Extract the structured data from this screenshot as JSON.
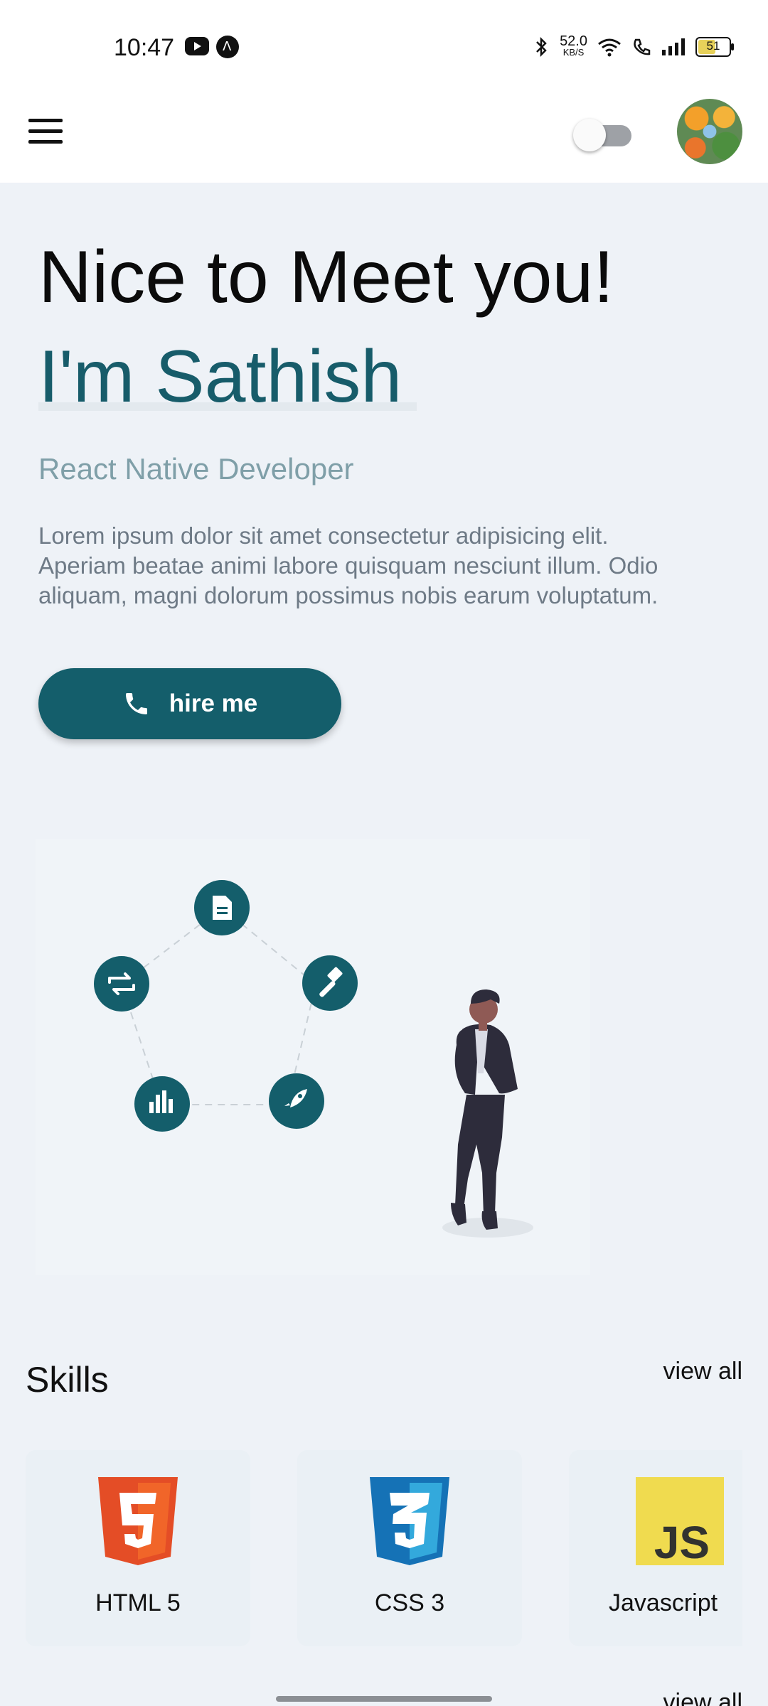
{
  "status_bar": {
    "time": "10:47",
    "net_speed": "52.0",
    "net_unit": "KB/S",
    "battery": "51",
    "icons": [
      "youtube-icon",
      "navigation-a-icon",
      "bluetooth-icon",
      "wifi-icon",
      "call-icon",
      "signal-icon",
      "battery-icon"
    ]
  },
  "app_bar": {
    "menu_icon": "hamburger-menu-icon",
    "toggle_on": false
  },
  "hero": {
    "greeting": "Nice to Meet you!",
    "name": "I'm Sathish",
    "role": "React Native Developer",
    "description": "Lorem ipsum dolor sit amet consectetur adipisicing elit. Aperiam beatae animi labore quisquam nesciunt illum. Odio aliquam, magni dolorum possimus nobis earum voluptatum.",
    "hire_button": "hire me",
    "hire_icon": "phone-icon"
  },
  "illustration": {
    "cycle_icons": [
      "document-icon",
      "hammer-icon",
      "rocket-icon",
      "bar-chart-icon",
      "repeat-icon"
    ]
  },
  "skills": {
    "title": "Skills",
    "view_all": "view all",
    "items": [
      {
        "label": "HTML 5"
      },
      {
        "label": "CSS 3"
      },
      {
        "label": "Javascript"
      }
    ],
    "cut_off_link": "view all"
  },
  "colors": {
    "accent": "#145e6b",
    "background": "#eef2f7",
    "role_text": "#7f9fa8"
  }
}
